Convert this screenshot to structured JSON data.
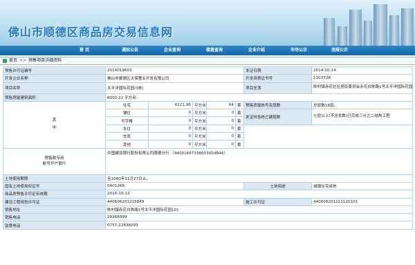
{
  "header": {
    "site_title": "佛山市顺德区商品房交易信息网"
  },
  "nav": {
    "items": [
      "首 页",
      "通知公告",
      "企业查询",
      "楼盘查询",
      "企业介绍",
      "市场公示",
      "违规公示"
    ]
  },
  "breadcrumb": {
    "home": "首页",
    "separator": ">>",
    "current": "预售项目详细资料"
  },
  "info": {
    "permit_no_label": "预售许可证编号",
    "permit_no": "2014019603",
    "issue_date_label": "发证日期",
    "issue_date": "2014-10-14",
    "developer_label": "开发企业名称",
    "developer": "佛山市顺德区太保置业开发有限公司",
    "qual_label": "开发资质证书号",
    "qual": "1303728",
    "project_label": "项目名称",
    "project": "太平洋国际花园(3栋)",
    "location_label": "项目坐落",
    "location": "陈村镇赤花社区居民委员会赤花白陈路1号太平洋国际花园",
    "area_label": "预售房屋建筑面积",
    "area": "8002.22 平方米",
    "qizhong": "其\n中",
    "rows": [
      {
        "name": "住宅",
        "area": "6111.96",
        "unit": "平方米",
        "count": "64",
        "count_unit": "套"
      },
      {
        "name": "铺位",
        "area": "0",
        "unit": "平方米",
        "count": "0",
        "count_unit": "套"
      },
      {
        "name": "写字楼",
        "area": "0",
        "unit": "平方米",
        "count": "0",
        "count_unit": "套"
      },
      {
        "name": "车位",
        "area": "0",
        "unit": "平方米",
        "count": "0",
        "count_unit": "套"
      },
      {
        "name": "车库",
        "area": "0",
        "unit": "平方米",
        "count": "0",
        "count_unit": "套"
      },
      {
        "name": "其他",
        "area": "0",
        "unit": "平方米",
        "count": "0",
        "count_unit": "套"
      }
    ],
    "floors_label": "预售房屋栋号及层数",
    "floors": "总层数18层。",
    "progress_label": "发证时各栋已建层数",
    "progress": "七层以上(不含本数)已完成三分之二结构工程",
    "bank_label": "预售款专用\n帐号开户银行",
    "bank": "中国建设银行股份有限公司顺德分行 （44001667338053004844）",
    "land_term_label": "土地使用期限",
    "land_term": "至2080年11月27日止。",
    "land_cert_label": "国有土地使用权证号",
    "land_cert": "0401268",
    "land_use_label": "土地用途",
    "land_use": "城镇住宅用地",
    "validity_label": "商品房预售许可证有效期",
    "validity": "2016-10-13",
    "plan_permit_label": "建设工程规划许可证",
    "plan_permit": "440606201215849",
    "build_permit_label": "施工许可证",
    "build_permit": "440606201211120101",
    "sales_addr_label": "销售地址",
    "sales_addr": "陈村镇赤花白陈路1号太平洋国际花园101",
    "sales_tel_label": "销售电话",
    "sales_tel": "29268999",
    "supervise_tel_label": "监督电话",
    "supervise_tel": "0757-22836093"
  }
}
